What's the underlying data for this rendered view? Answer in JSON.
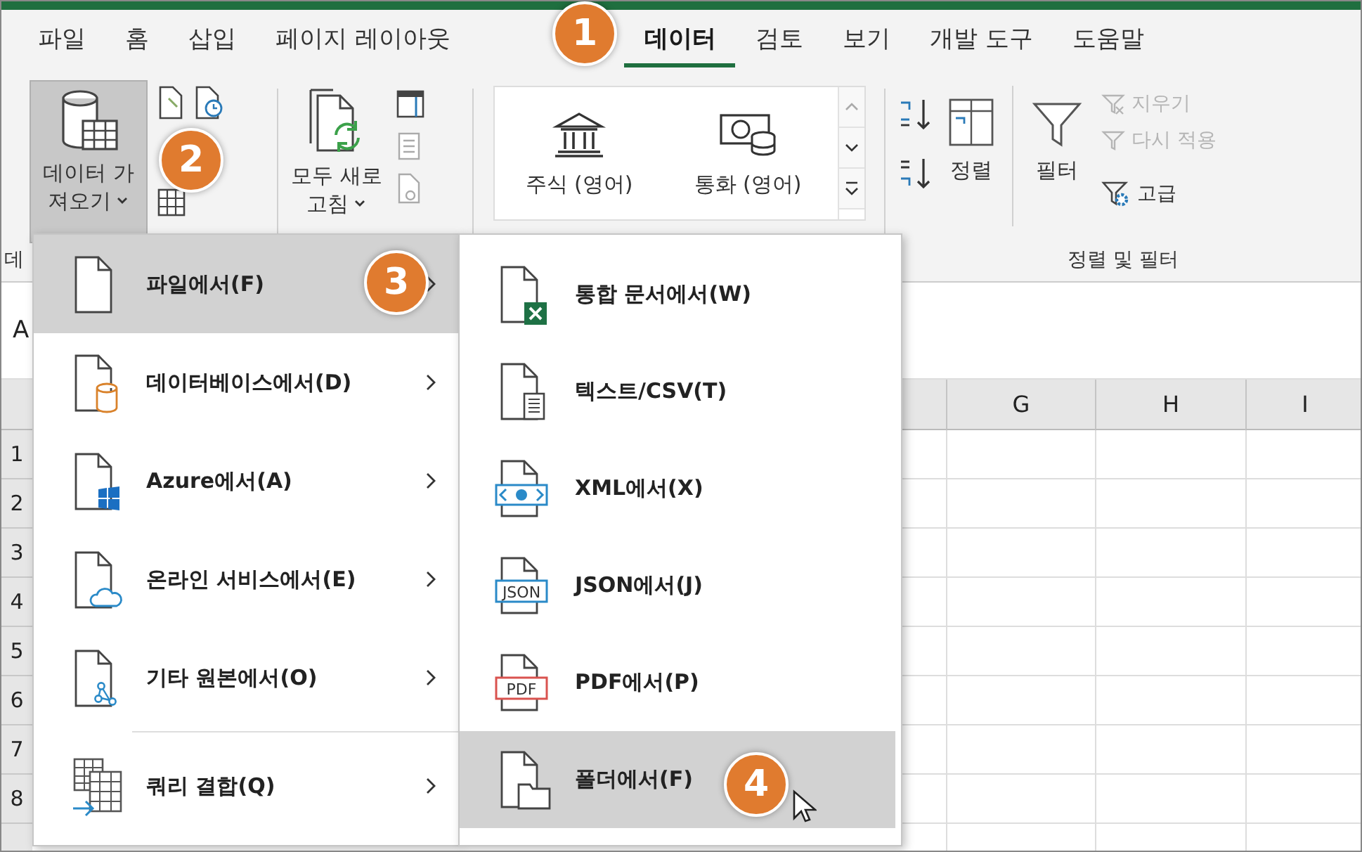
{
  "tabs": [
    {
      "label": "파일",
      "selected": false
    },
    {
      "label": "홈",
      "selected": false
    },
    {
      "label": "삽입",
      "selected": false
    },
    {
      "label": "페이지 레이아웃",
      "selected": false
    },
    {
      "label": "데이터",
      "selected": true
    },
    {
      "label": "검토",
      "selected": false
    },
    {
      "label": "보기",
      "selected": false
    },
    {
      "label": "개발 도구",
      "selected": false
    },
    {
      "label": "도움말",
      "selected": false
    }
  ],
  "ribbon": {
    "get_data": {
      "lines": [
        "데이터 가",
        "져오기"
      ],
      "selected": true
    },
    "refresh_all": {
      "lines": [
        "모두 새로",
        "고침"
      ]
    },
    "data_types": [
      "주식 (영어)",
      "통화 (영어)"
    ],
    "sort_filter": {
      "sort": "정렬",
      "filter": "필터",
      "clear": {
        "label": "지우기",
        "disabled": true
      },
      "reapply": {
        "label": "다시 적용",
        "disabled": true
      },
      "advanced": {
        "label": "고급",
        "disabled": false
      },
      "group_label": "정렬 및 필터"
    },
    "first_group_label": "데"
  },
  "name_box": "A",
  "columns": [
    "G",
    "H",
    "I"
  ],
  "rows": [
    "1",
    "2",
    "3",
    "4",
    "5",
    "6",
    "7",
    "8"
  ],
  "menu": [
    {
      "label": "파일에서(F)",
      "kind": "file",
      "selected": true
    },
    {
      "label": "데이터베이스에서(D)",
      "kind": "database",
      "selected": false
    },
    {
      "label": "Azure에서(A)",
      "kind": "azure",
      "selected": false
    },
    {
      "label": "온라인 서비스에서(E)",
      "kind": "cloud",
      "selected": false
    },
    {
      "label": "기타 원본에서(O)",
      "kind": "other",
      "selected": false
    },
    {
      "label": "쿼리 결합(Q)",
      "kind": "combine",
      "selected": false
    }
  ],
  "submenu": [
    {
      "label": "통합 문서에서(W)",
      "kind": "workbook",
      "selected": false
    },
    {
      "label": "텍스트/CSV(T)",
      "kind": "text",
      "selected": false
    },
    {
      "label": "XML에서(X)",
      "kind": "xml",
      "selected": false
    },
    {
      "label": "JSON에서(J)",
      "kind": "json",
      "icon_text": "JSON",
      "selected": false
    },
    {
      "label": "PDF에서(P)",
      "kind": "pdf",
      "icon_text": "PDF",
      "selected": false
    },
    {
      "label": "폴더에서(F)",
      "kind": "folder",
      "selected": true
    }
  ],
  "callouts": [
    "1",
    "2",
    "3",
    "4"
  ]
}
